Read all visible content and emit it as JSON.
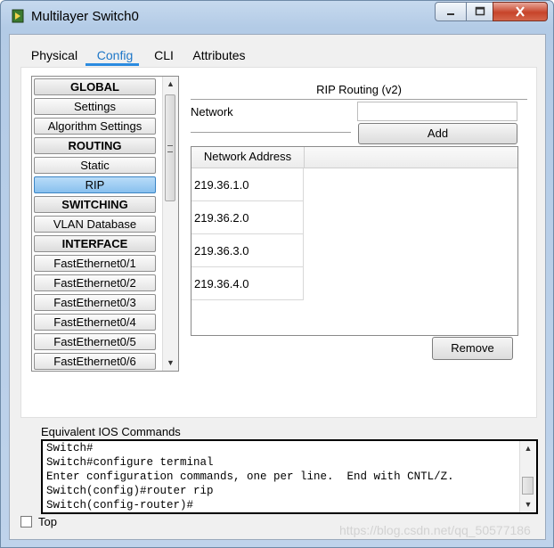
{
  "window": {
    "title": "Multilayer Switch0"
  },
  "tabs": [
    "Physical",
    "Config",
    "CLI",
    "Attributes"
  ],
  "active_tab": "Config",
  "nav": {
    "items": [
      {
        "label": "GLOBAL",
        "header": true
      },
      {
        "label": "Settings"
      },
      {
        "label": "Algorithm Settings"
      },
      {
        "label": "ROUTING",
        "header": true
      },
      {
        "label": "Static"
      },
      {
        "label": "RIP",
        "selected": true
      },
      {
        "label": "SWITCHING",
        "header": true
      },
      {
        "label": "VLAN Database"
      },
      {
        "label": "INTERFACE",
        "header": true
      },
      {
        "label": "FastEthernet0/1"
      },
      {
        "label": "FastEthernet0/2"
      },
      {
        "label": "FastEthernet0/3"
      },
      {
        "label": "FastEthernet0/4"
      },
      {
        "label": "FastEthernet0/5"
      },
      {
        "label": "FastEthernet0/6"
      }
    ]
  },
  "rip": {
    "title": "RIP Routing (v2)",
    "network_label": "Network",
    "network_value": "",
    "add_label": "Add",
    "remove_label": "Remove",
    "table_header": "Network Address",
    "networks": [
      "219.36.1.0",
      "219.36.2.0",
      "219.36.3.0",
      "219.36.4.0"
    ]
  },
  "ios": {
    "label": "Equivalent IOS Commands",
    "lines": [
      "Switch#",
      "Switch#configure terminal",
      "Enter configuration commands, one per line.  End with CNTL/Z.",
      "Switch(config)#router rip",
      "Switch(config-router)#"
    ]
  },
  "footer": {
    "top_label": "Top",
    "top_checked": false,
    "watermark": "https://blog.csdn.net/qq_50577186"
  }
}
